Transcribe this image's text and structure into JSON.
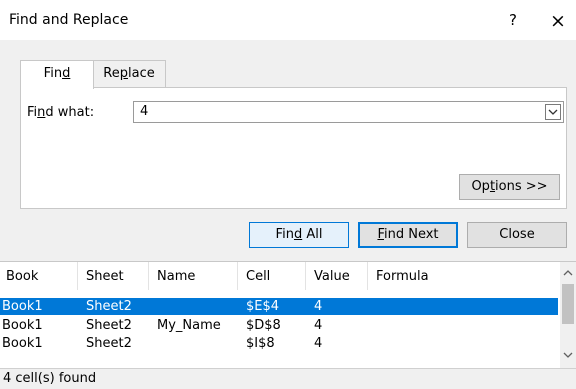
{
  "window": {
    "title": "Find and Replace",
    "help_label": "?",
    "close_label": "×"
  },
  "tabs": [
    {
      "label": "Find",
      "mnemonic_index": 3,
      "active": true
    },
    {
      "label": "Replace",
      "mnemonic_index": 2,
      "active": false
    }
  ],
  "find": {
    "label": "Find what:",
    "value": "4"
  },
  "buttons": {
    "options": "Options >>",
    "find_all": "Find All",
    "find_next": "Find Next",
    "close": "Close"
  },
  "results": {
    "columns": [
      "Book",
      "Sheet",
      "Name",
      "Cell",
      "Value",
      "Formula"
    ],
    "rows": [
      {
        "book": "Book1",
        "sheet": "Sheet2",
        "name": "",
        "cell": "$E$4",
        "value": "4",
        "formula": "",
        "selected": true
      },
      {
        "book": "Book1",
        "sheet": "Sheet2",
        "name": "My_Name",
        "cell": "$D$8",
        "value": "4",
        "formula": "",
        "selected": false
      },
      {
        "book": "Book1",
        "sheet": "Sheet2",
        "name": "",
        "cell": "$I$8",
        "value": "4",
        "formula": "",
        "selected": false
      }
    ]
  },
  "status": "4 cell(s) found",
  "colors": {
    "accent": "#0078d7",
    "dialog_bg": "#f0f0f0"
  }
}
